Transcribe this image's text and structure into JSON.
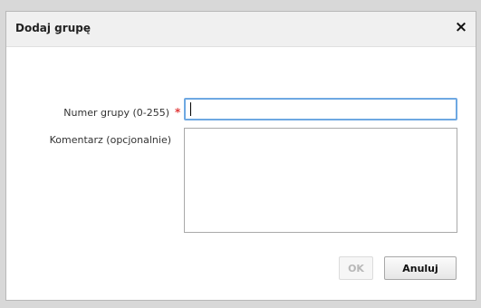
{
  "dialog": {
    "title": "Dodaj grupę",
    "close_symbol": "×",
    "close_icon": "close-icon"
  },
  "form": {
    "group_number_label": "Numer grupy (0-255)",
    "required_marker": "*",
    "group_number_value": "",
    "comment_label": "Komentarz (opcjonalnie)",
    "comment_value": ""
  },
  "buttons": {
    "ok_label": "OK",
    "cancel_label": "Anuluj"
  },
  "colors": {
    "required": "#e03a3a",
    "focus_border": "#6ea8e2"
  }
}
